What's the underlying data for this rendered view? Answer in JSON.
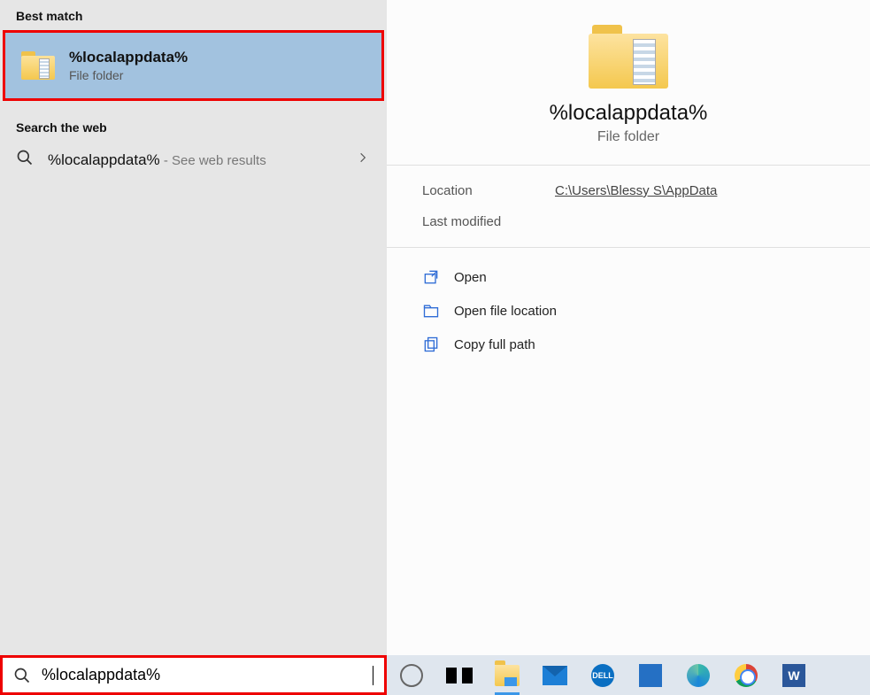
{
  "left": {
    "best_match_header": "Best match",
    "best_match": {
      "title": "%localappdata%",
      "subtitle": "File folder"
    },
    "web_header": "Search the web",
    "web_result": {
      "term": "%localappdata%",
      "hint": " - See web results"
    }
  },
  "preview": {
    "title": "%localappdata%",
    "subtitle": "File folder",
    "location_label": "Location",
    "location_value": "C:\\Users\\Blessy S\\AppData",
    "modified_label": "Last modified",
    "actions": {
      "open": "Open",
      "open_location": "Open file location",
      "copy_path": "Copy full path"
    }
  },
  "searchbox": {
    "value": "%localappdata%"
  },
  "taskbar": {
    "dell": "DELL",
    "word": "W"
  }
}
